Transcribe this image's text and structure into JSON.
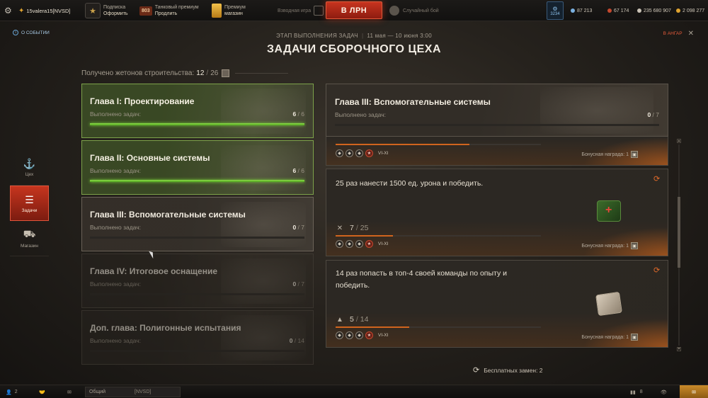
{
  "topbar": {
    "player_name": "15valera15[NVSD]",
    "subscription": {
      "line1": "Подписка",
      "line2": "Оформить"
    },
    "premium": {
      "days": "803",
      "line1": "Танковый премиум",
      "line2": "Продлить"
    },
    "shop": {
      "line1": "Премиум",
      "line2": "магазин"
    },
    "mode": "Взводная игра",
    "battle_button": "В ЛРН",
    "random": "Случайный бой",
    "tokens_value": "3234",
    "currencies": [
      {
        "value": "87 213",
        "color": "#7ab0e0"
      },
      {
        "value": "67 174",
        "color": "#c4482e"
      },
      {
        "value": "235 680 907",
        "color": "#c9c2b6"
      },
      {
        "value": "2 098 277",
        "color": "#e0a430"
      }
    ]
  },
  "header": {
    "about": "О СОБЫТИИ",
    "hangar": "В АНГАР",
    "stage_label": "ЭТАП ВЫПОЛНЕНИЯ ЗАДАЧ",
    "stage_dates": "11 мая — 10 июня 3:00",
    "title": "ЗАДАЧИ СБОРОЧНОГО ЦЕХА",
    "received_label": "Получено жетонов строительства:",
    "received_value": "12",
    "received_total": "26"
  },
  "leftnav": [
    {
      "label": "Цех",
      "icon": "crane-icon"
    },
    {
      "label": "Задачи",
      "icon": "tasks-icon",
      "active": true
    },
    {
      "label": "Магазин",
      "icon": "cart-icon"
    }
  ],
  "chapters": [
    {
      "name": "Глава I: Проектирование",
      "label": "Выполнено задач:",
      "done": "6",
      "total": "6",
      "progress": 1.0,
      "state": "done"
    },
    {
      "name": "Глава II: Основные системы",
      "label": "Выполнено задач:",
      "done": "6",
      "total": "6",
      "progress": 1.0,
      "state": "done"
    },
    {
      "name": "Глава III: Вспомогательные системы",
      "label": "Выполнено задач:",
      "done": "0",
      "total": "7",
      "progress": 0.0,
      "state": "active"
    },
    {
      "name": "Глава IV: Итоговое оснащение",
      "label": "Выполнено задач:",
      "done": "0",
      "total": "7",
      "progress": 0.0,
      "state": "locked"
    },
    {
      "name": "Доп. глава: Полигонные испытания",
      "label": "Выполнено задач:",
      "done": "0",
      "total": "14",
      "progress": 0.0,
      "state": "locked"
    }
  ],
  "detail": {
    "name": "Глава III: Вспомогательные системы",
    "label": "Выполнено задач:",
    "done": "0",
    "total": "7"
  },
  "tasks": [
    {
      "desc": "",
      "current": "",
      "total": "",
      "progress": 0.65,
      "tier": "VI-XI",
      "bonus": "Бонусная награда: 1"
    },
    {
      "desc": "25 раз нанести 1500 ед. урона и победить.",
      "current": "7",
      "total": "25",
      "progress": 0.28,
      "tier": "VI-XI",
      "bonus": "Бонусная награда: 1"
    },
    {
      "desc": "14 раз попасть в топ-4 своей команды по опыту и победить.",
      "current": "5",
      "total": "14",
      "progress": 0.36,
      "tier": "VI-XI",
      "bonus": "Бонусная награда: 1"
    }
  ],
  "free_swaps": "Бесплатных замен: 2",
  "botbar": {
    "players": "2",
    "chat": "Общий",
    "clan": "[NVSD]",
    "count": "8"
  }
}
